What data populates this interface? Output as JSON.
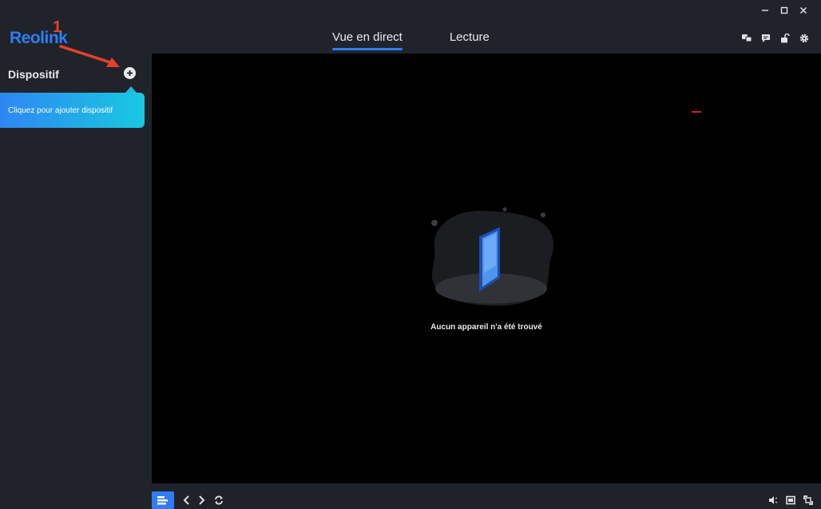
{
  "app": {
    "logo": "Reolink"
  },
  "window_controls": [
    "minimize-icon",
    "maximize-icon",
    "close-icon"
  ],
  "tabs": [
    {
      "label": "Vue en direct",
      "active": true
    },
    {
      "label": "Lecture",
      "active": false
    }
  ],
  "top_icons": [
    "chat-bubbles-icon",
    "message-icon",
    "unlock-icon",
    "gear-icon"
  ],
  "sidebar": {
    "title": "Dispositif",
    "add_icon": "plus-circle-icon",
    "tooltip": "Cliquez pour ajouter dispositif"
  },
  "main": {
    "empty_message": "Aucun appareil n'a été trouvé"
  },
  "annotation": {
    "number": "1"
  },
  "bottom_left_icons": [
    "layout-icon",
    "chevron-left-icon",
    "chevron-right-icon",
    "refresh-icon"
  ],
  "bottom_right_icons": [
    "volume-icon",
    "screen-icon",
    "fullscreen-icon"
  ],
  "colors": {
    "accent": "#2f7cf6",
    "annotation": "#e8412a",
    "background": "#1f2329",
    "video": "#000000"
  }
}
